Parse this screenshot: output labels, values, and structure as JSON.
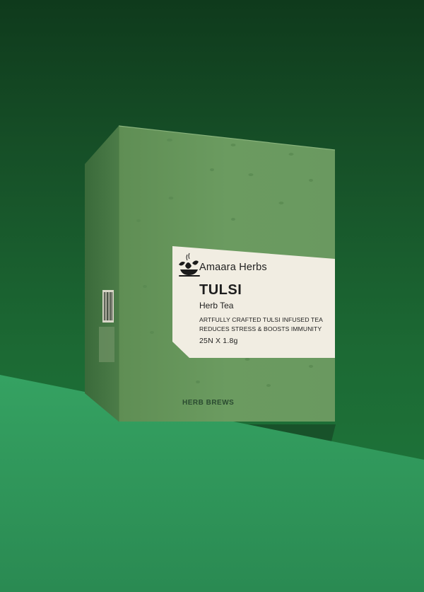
{
  "label": {
    "brand": "Amaara Herbs",
    "product": "TULSI",
    "subtitle": "Herb Tea",
    "tagline_1": "ARTFULLY CRAFTED TULSI INFUSED TEA",
    "tagline_2": "REDUCES STRESS & BOOSTS IMMUNITY",
    "quantity": "25N X 1.8g"
  },
  "box": {
    "bottom_brand": "HERB BREWS"
  },
  "colors": {
    "backdrop_dark": "#0f3a1c",
    "floor": "#2f9a5c",
    "box_front": "#6a9a5e",
    "label_bg": "#f1ede2"
  },
  "icons": [
    "teacup-leaf-logo-icon"
  ]
}
